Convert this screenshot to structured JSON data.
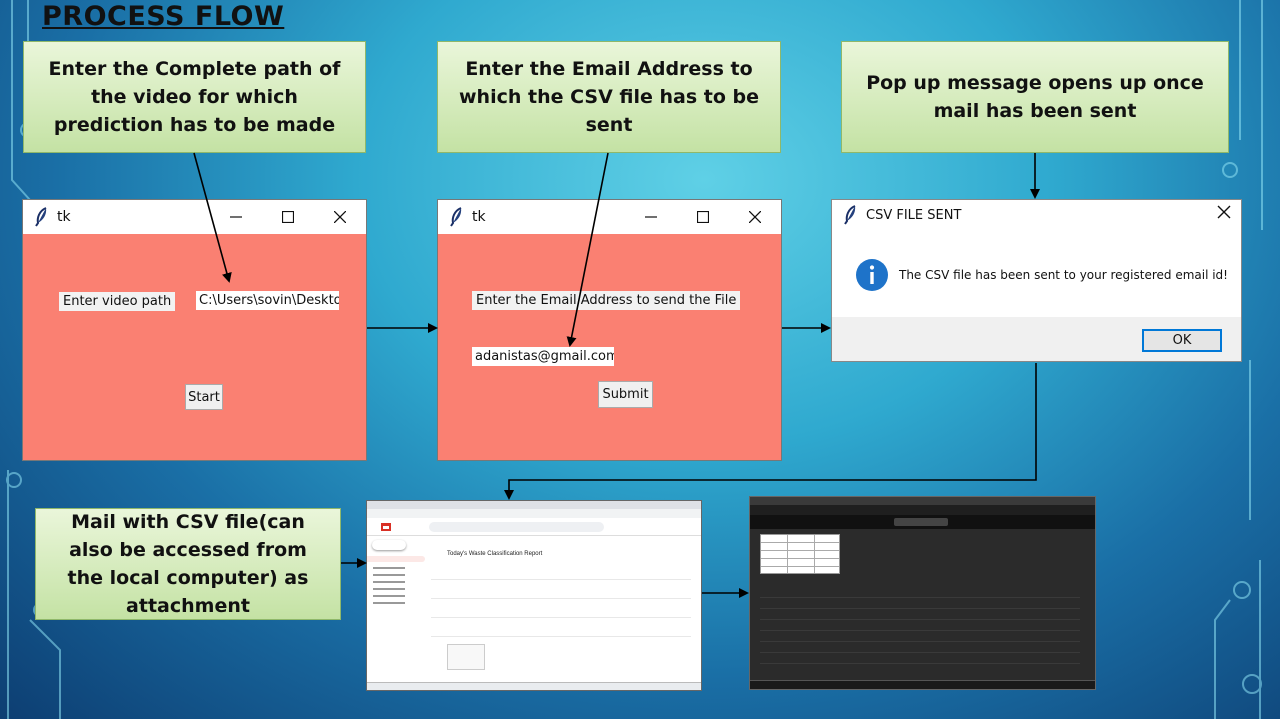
{
  "slide": {
    "title": "PROCESS FLOW",
    "callouts": {
      "step1": "Enter the Complete path of the video for which prediction has to be made",
      "step2": "Enter the Email Address to which the CSV file has to be sent",
      "step3": "Pop up message opens up once mail has been sent",
      "step4": "Mail with CSV file(can also be accessed from the local computer) as attachment"
    }
  },
  "window1": {
    "title": "tk",
    "label": "Enter video path",
    "entry_value": "C:\\Users\\sovin\\Desktop",
    "button": "Start"
  },
  "window2": {
    "title": "tk",
    "label": "Enter the Email Address to send the File",
    "entry_value": "adanistas@gmail.com",
    "button": "Submit"
  },
  "popup": {
    "title": "CSV FILE SENT",
    "message": "The CSV file has been sent to your registered email id!",
    "ok": "OK",
    "icon": "info-icon"
  },
  "gmail": {
    "subject": "Today's Waste Classification Report"
  },
  "colors": {
    "tk_bg": "#fa8072",
    "callout_top": "#eaf6da",
    "callout_bottom": "#c4e2a4",
    "accent": "#0078d7"
  }
}
